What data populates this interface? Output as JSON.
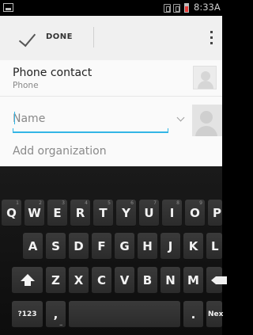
{
  "status_bar": {
    "time": "8:33A"
  },
  "action_bar": {
    "done_label": "DONE"
  },
  "account": {
    "title": "Phone contact",
    "subtitle": "Phone"
  },
  "name_field": {
    "placeholder": "Name",
    "value": ""
  },
  "add_organization_label": "Add organization",
  "keyboard": {
    "row1": [
      {
        "label": "Q",
        "hint": "1"
      },
      {
        "label": "W",
        "hint": "2"
      },
      {
        "label": "E",
        "hint": "3"
      },
      {
        "label": "R",
        "hint": "4"
      },
      {
        "label": "T",
        "hint": "5"
      },
      {
        "label": "Y",
        "hint": "6"
      },
      {
        "label": "U",
        "hint": "7"
      },
      {
        "label": "I",
        "hint": "8"
      },
      {
        "label": "O",
        "hint": "9"
      },
      {
        "label": "P",
        "hint": "0"
      }
    ],
    "row2": [
      "A",
      "S",
      "D",
      "F",
      "G",
      "H",
      "J",
      "K",
      "L"
    ],
    "row3": [
      "Z",
      "X",
      "C",
      "V",
      "B",
      "N",
      "M"
    ],
    "symbols_label": "?123",
    "comma": ",",
    "comma_hint": "_",
    "period": ".",
    "next_label": "Nex"
  },
  "icons": {
    "status": [
      "screenshot-icon",
      "sim-card-icon",
      "sim-card-icon",
      "battery-icon"
    ],
    "action": [
      "check-icon",
      "overflow-menu-icon"
    ],
    "form": [
      "contact-avatar-icon",
      "expand-icon",
      "contact-photo-icon"
    ],
    "keyboard": [
      "shift-icon",
      "backspace-icon"
    ]
  },
  "colors": {
    "accent": "#33b5e5",
    "battery_low": "#e53935",
    "keyboard_bg": "#111111",
    "key_bg": "#333333"
  }
}
